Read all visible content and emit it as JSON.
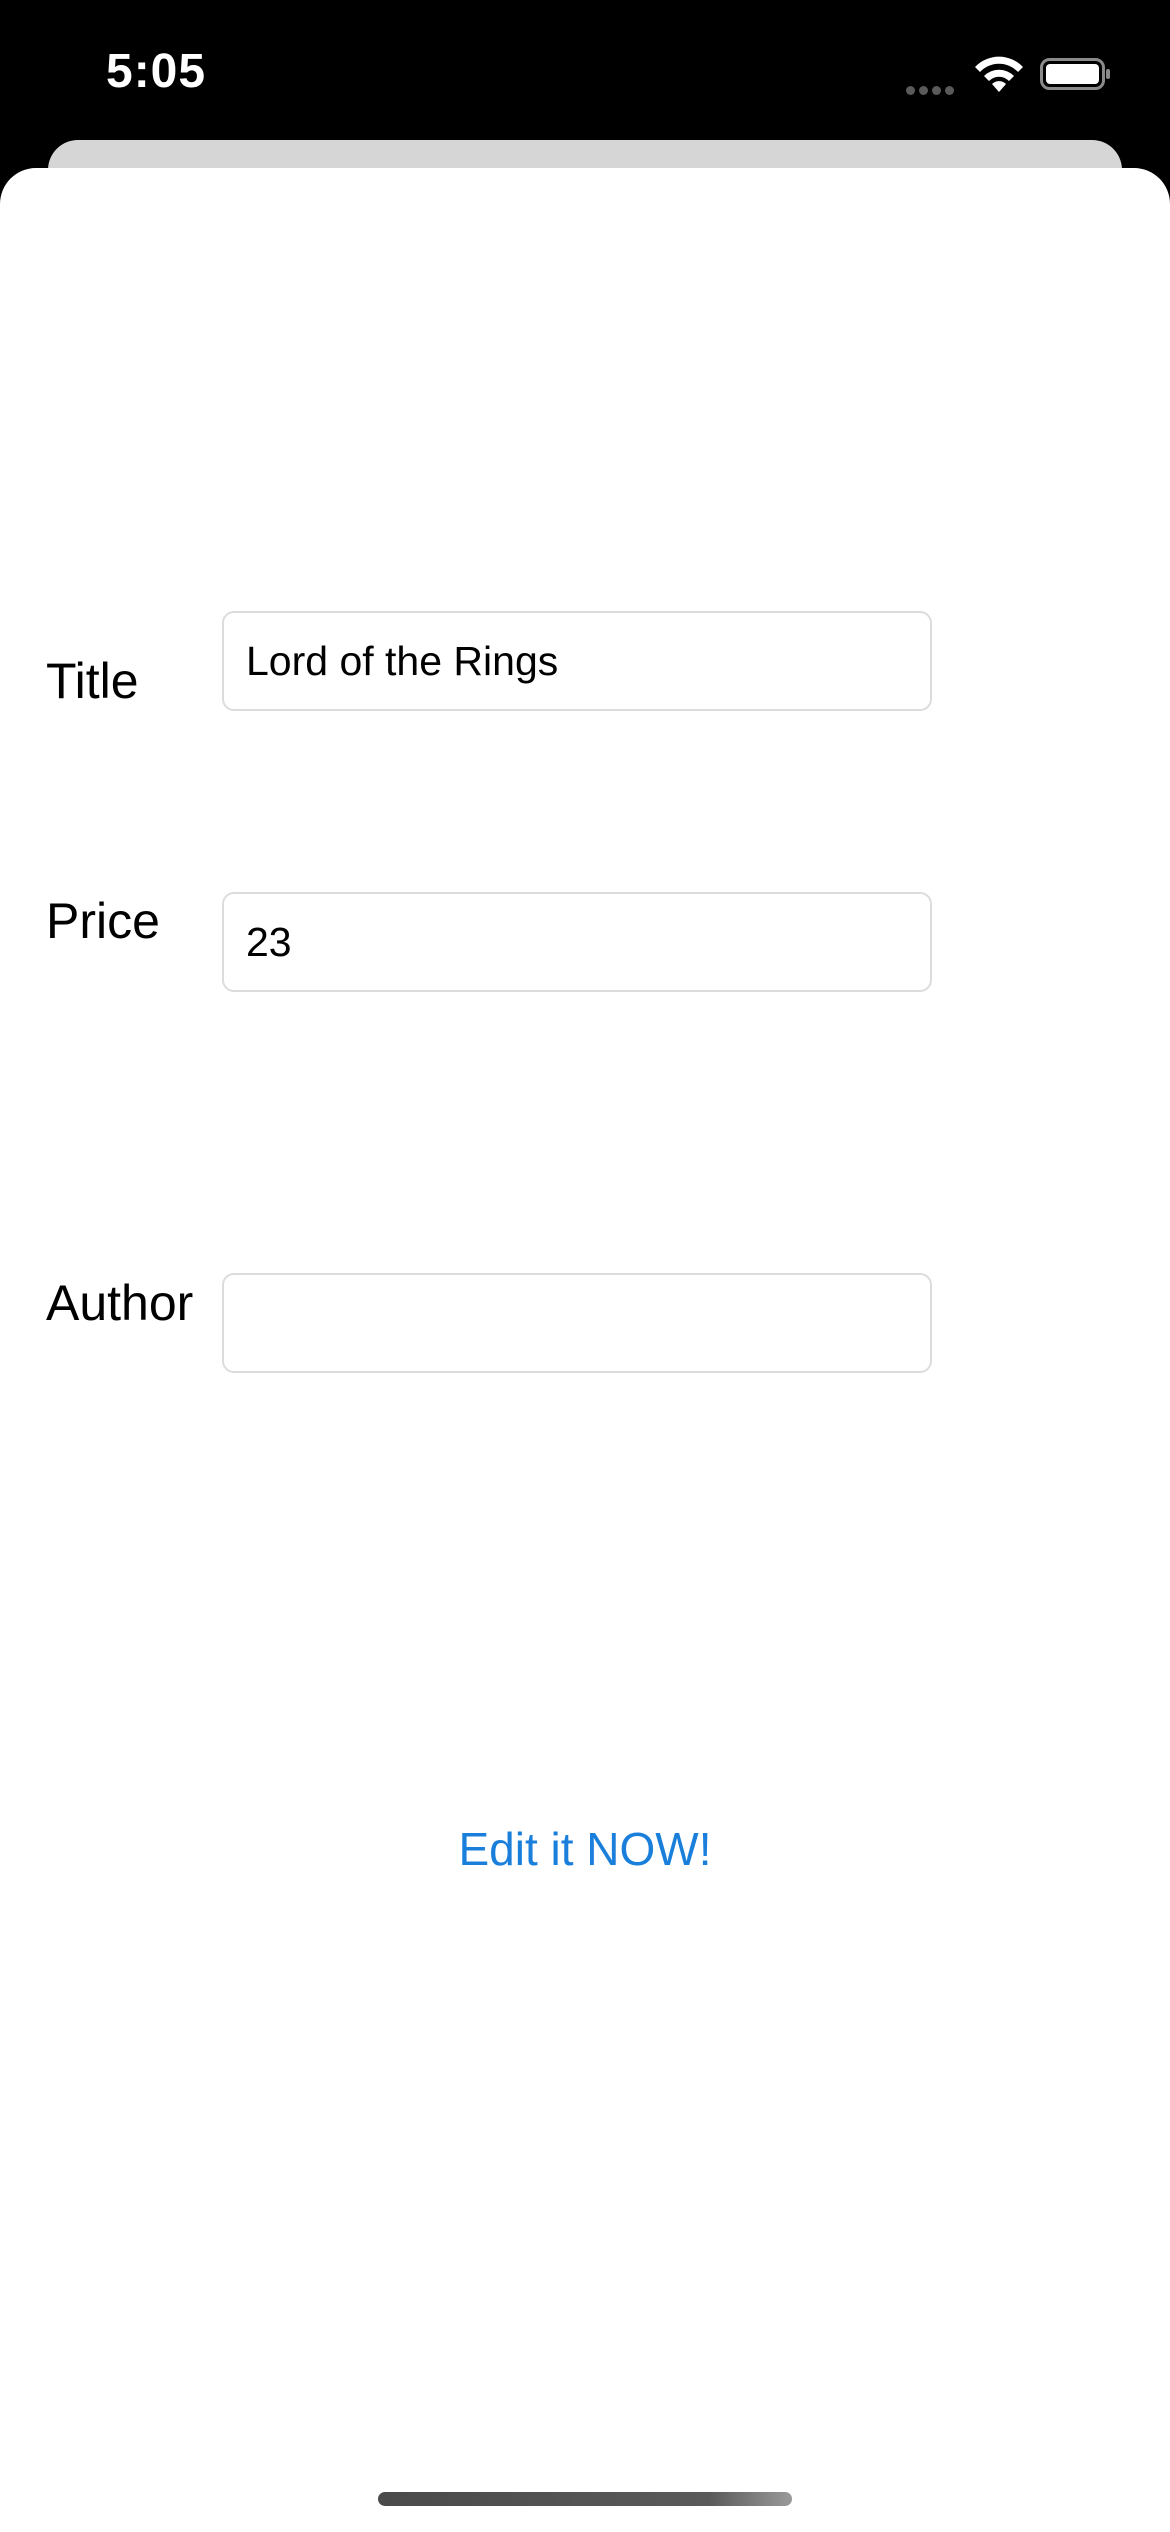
{
  "status_bar": {
    "time": "5:05",
    "signal_icon": "cellular-dots-icon",
    "wifi_icon": "wifi-icon",
    "battery_icon": "battery-icon"
  },
  "form": {
    "title": {
      "label": "Title",
      "value": "Lord of the Rings"
    },
    "price": {
      "label": "Price",
      "value": "23"
    },
    "author": {
      "label": "Author",
      "value": ""
    }
  },
  "actions": {
    "edit_label": "Edit it NOW!"
  },
  "colors": {
    "accent": "#1a7fdb",
    "status_bar_bg": "#000000",
    "sheet_bg": "#ffffff",
    "field_border": "#dcdcdc"
  }
}
